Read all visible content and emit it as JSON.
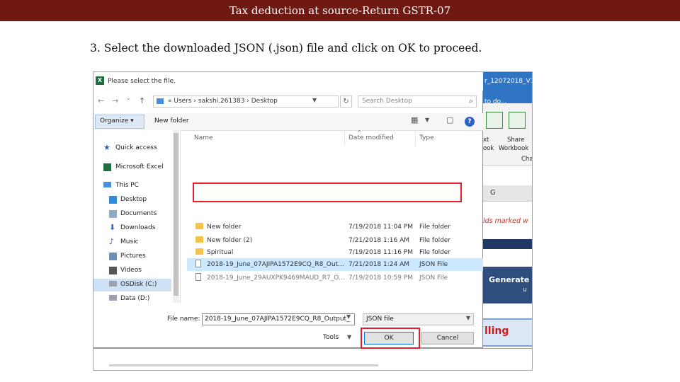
{
  "slide": {
    "title": "Tax deduction at source-Return GSTR-07",
    "instruction": "3. Select the downloaded JSON (.json) file and click on OK to proceed."
  },
  "excel_background": {
    "header_text": "r_12072018_V1",
    "header_text2": "to do...",
    "ribbon_labels": [
      "xt",
      "Share",
      "ook",
      "Workbook",
      "Cha"
    ],
    "column_letter": "G",
    "note": "lds marked w",
    "generate_label": "Generate",
    "generate_sub": "u",
    "filing_label": "lling"
  },
  "dialog": {
    "title": "Please select the file.",
    "nav": {
      "back": "←",
      "forward": "→",
      "up": "↑",
      "down": "⌄"
    },
    "address_path": "«  Users  ›  sakshi.261383  ›  Desktop",
    "search_placeholder": "Search Desktop",
    "toolbar": {
      "organize": "Organize ▾",
      "new_folder": "New folder"
    },
    "nav_pane": [
      {
        "label": "Quick access",
        "icon": "star-icon"
      },
      {
        "label": "Microsoft Excel",
        "icon": "excel-icon"
      },
      {
        "label": "This PC",
        "icon": "computer-icon"
      },
      {
        "label": "Desktop",
        "icon": "desktop-icon"
      },
      {
        "label": "Documents",
        "icon": "documents-icon"
      },
      {
        "label": "Downloads",
        "icon": "downloads-icon"
      },
      {
        "label": "Music",
        "icon": "music-icon"
      },
      {
        "label": "Pictures",
        "icon": "pictures-icon"
      },
      {
        "label": "Videos",
        "icon": "videos-icon"
      },
      {
        "label": "OSDisk (C:)",
        "icon": "drive-icon",
        "selected": true
      },
      {
        "label": "Data (D:)",
        "icon": "drive-icon"
      }
    ],
    "columns": {
      "name": "Name",
      "date": "Date modified",
      "type": "Type"
    },
    "files": [
      {
        "name": "New folder",
        "date": "7/19/2018 11:04 PM",
        "type": "File folder",
        "kind": "folder"
      },
      {
        "name": "New folder (2)",
        "date": "7/21/2018 1:16 AM",
        "type": "File folder",
        "kind": "folder"
      },
      {
        "name": "Spiritual",
        "date": "7/19/2018 11:16 PM",
        "type": "File folder",
        "kind": "folder"
      },
      {
        "name": "2018-19_June_07AJIPA1572E9CQ_R8_Out...",
        "date": "7/21/2018 1:24 AM",
        "type": "JSON File",
        "kind": "json",
        "selected": true
      },
      {
        "name": "2018-19_June_29AUXPK9469MAUD_R7_O...",
        "date": "7/19/2018 10:59 PM",
        "type": "JSON File",
        "kind": "json"
      }
    ],
    "file_name_label": "File name:",
    "file_name_value": "2018-19_June_07AJIPA1572E9CQ_R8_Output_",
    "file_type_value": "JSON file",
    "tools_label": "Tools",
    "ok_label": "OK",
    "cancel_label": "Cancel"
  },
  "colors": {
    "title_bar": "#701913",
    "highlight_box": "#e3202a",
    "selected_row": "#cce8ff"
  }
}
